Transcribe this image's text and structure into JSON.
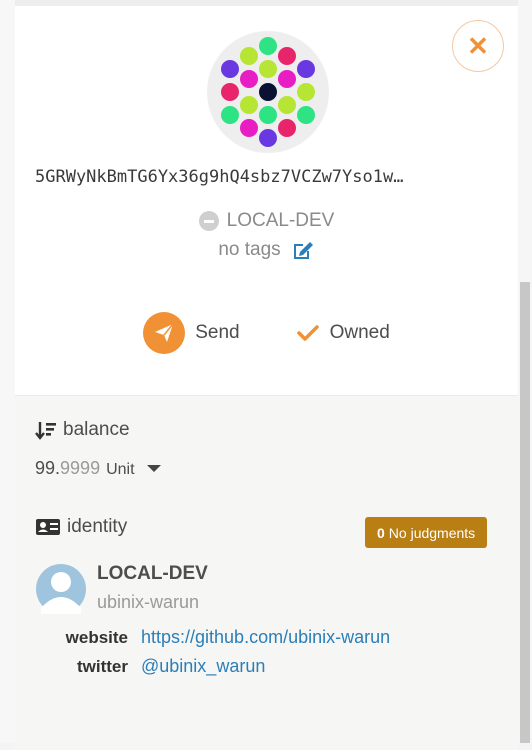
{
  "account": {
    "address": "5GRWyNkBmTG6Yx36g9hQ4sbz7VCZw7Yso1w…",
    "network": "LOCAL-DEV",
    "tags": "no tags"
  },
  "actions": {
    "send_label": "Send",
    "owned_label": "Owned"
  },
  "balance": {
    "title": "balance",
    "integer": "99.",
    "decimals": "9999",
    "unit": "Unit"
  },
  "identity": {
    "title": "identity",
    "judgments_count": "0",
    "judgments_label": "No judgments",
    "display_name": "LOCAL-DEV",
    "handle": "ubinix-warun",
    "fields": [
      {
        "label": "website",
        "value": "https://github.com/ubinix-warun"
      },
      {
        "label": "twitter",
        "value": "@ubinix_warun"
      }
    ]
  },
  "colors": {
    "accent": "#f19135",
    "judgment_badge": "#b97f14",
    "link": "#2b7fb8"
  },
  "icons": [
    "close-icon",
    "identicon",
    "minus-circle-icon",
    "edit-icon",
    "paper-plane-icon",
    "check-icon",
    "sort-amount-icon",
    "id-card-icon",
    "user-avatar-icon",
    "caret-down-icon"
  ]
}
